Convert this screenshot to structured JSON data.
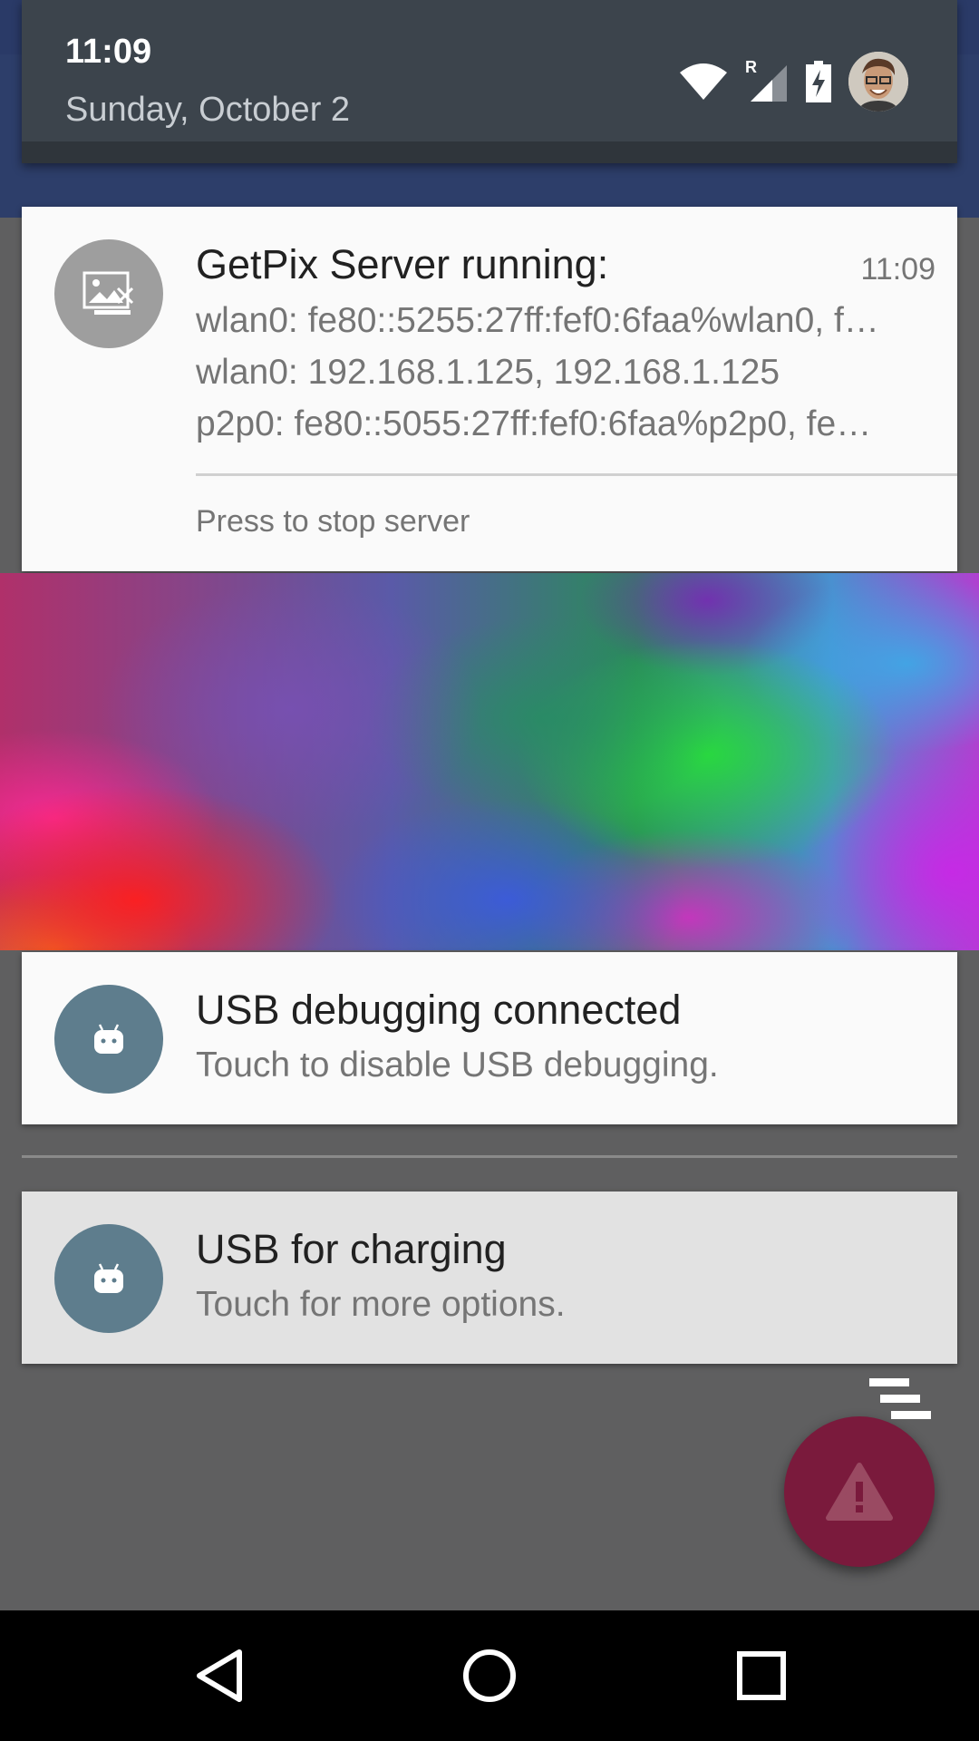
{
  "status": {
    "time": "11:09",
    "date": "Sunday, October 2",
    "signal_roaming_label": "R"
  },
  "notifications": [
    {
      "icon": "image-server-icon",
      "title": "GetPix Server running:",
      "time": "11:09",
      "lines": [
        "wlan0: fe80::5255:27ff:fef0:6faa%wlan0, f…",
        "wlan0: 192.168.1.125, 192.168.1.125",
        "p2p0: fe80::5055:27ff:fef0:6faa%p2p0, fe…"
      ],
      "action": "Press to stop server"
    },
    {
      "icon": "android-icon",
      "title": "USB debugging connected",
      "text": "Touch to disable USB debugging."
    },
    {
      "icon": "android-icon",
      "title": "USB for charging",
      "text": "Touch for more options."
    }
  ],
  "colors": {
    "fab": "#7a1a3c",
    "icon_circle_gray": "#9e9e9e",
    "icon_circle_blue": "#5e7d8d"
  }
}
